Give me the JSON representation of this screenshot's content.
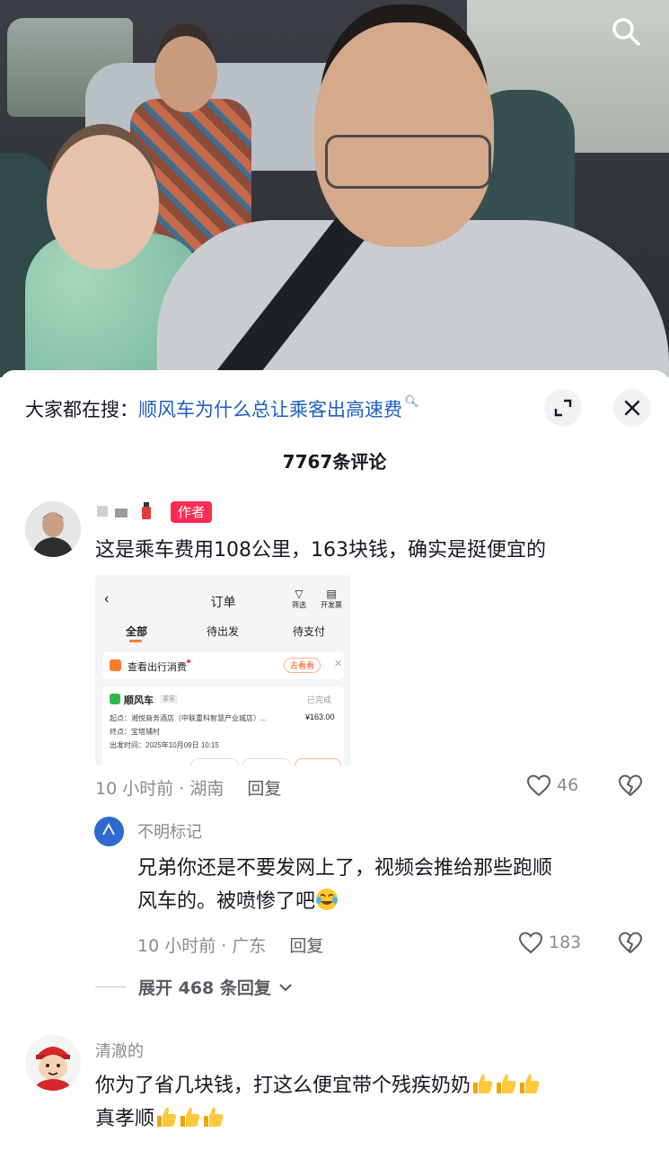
{
  "search_hint": {
    "prefix": "大家都在搜：",
    "term": "顺风车为什么总让乘客出高速费"
  },
  "comments_count_title": "7767条评论",
  "comments": [
    {
      "user_name": "",
      "author_tag": "作者",
      "text": "这是乘车费用108公里，163块钱，确实是挺便宜的",
      "time_location": "10 小时前 · 湖南",
      "reply_label": "回复",
      "likes": "46",
      "order_screenshot": {
        "title": "订单",
        "filter_label": "筛选",
        "invoice_label": "开发票",
        "tabs": [
          "全部",
          "待出发",
          "待支付"
        ],
        "prompt_text": "查看出行消费",
        "prompt_button": "去看看",
        "service": "顺风车",
        "role": "乘客",
        "status": "已完成",
        "origin": "起点：湘悦商务酒店（中联重科智慧产业城店）...",
        "destination": "终点：宝塔铺村",
        "depart_time": "出发时间：2025年10月09日 10:15",
        "price": "¥163.00"
      }
    },
    {
      "user_name": "不明标记",
      "text_line1": "兄弟你还是不要发网上了，视频会推给那些跑顺",
      "text_line2": "风车的。被喷惨了吧",
      "time_location": "10 小时前 · 广东",
      "reply_label": "回复",
      "likes": "183"
    },
    {
      "user_name": "清澈的",
      "text_line1": "你为了省几块钱，打这么便宜带个残疾奶奶",
      "text_line2": "真孝顺"
    }
  ],
  "expand_replies": "展开 468 条回复",
  "colors": {
    "link_blue": "#1f5fbf",
    "author_tag": "#fe2c55",
    "muted": "#8a8b91",
    "accent_orange": "#ff7a2b"
  },
  "icons": [
    "search-icon",
    "expand-icon",
    "close-icon",
    "heart-icon",
    "dislike-icon",
    "chevron-down-icon",
    "thumbs-up-emoji",
    "crying-laughing-emoji"
  ]
}
